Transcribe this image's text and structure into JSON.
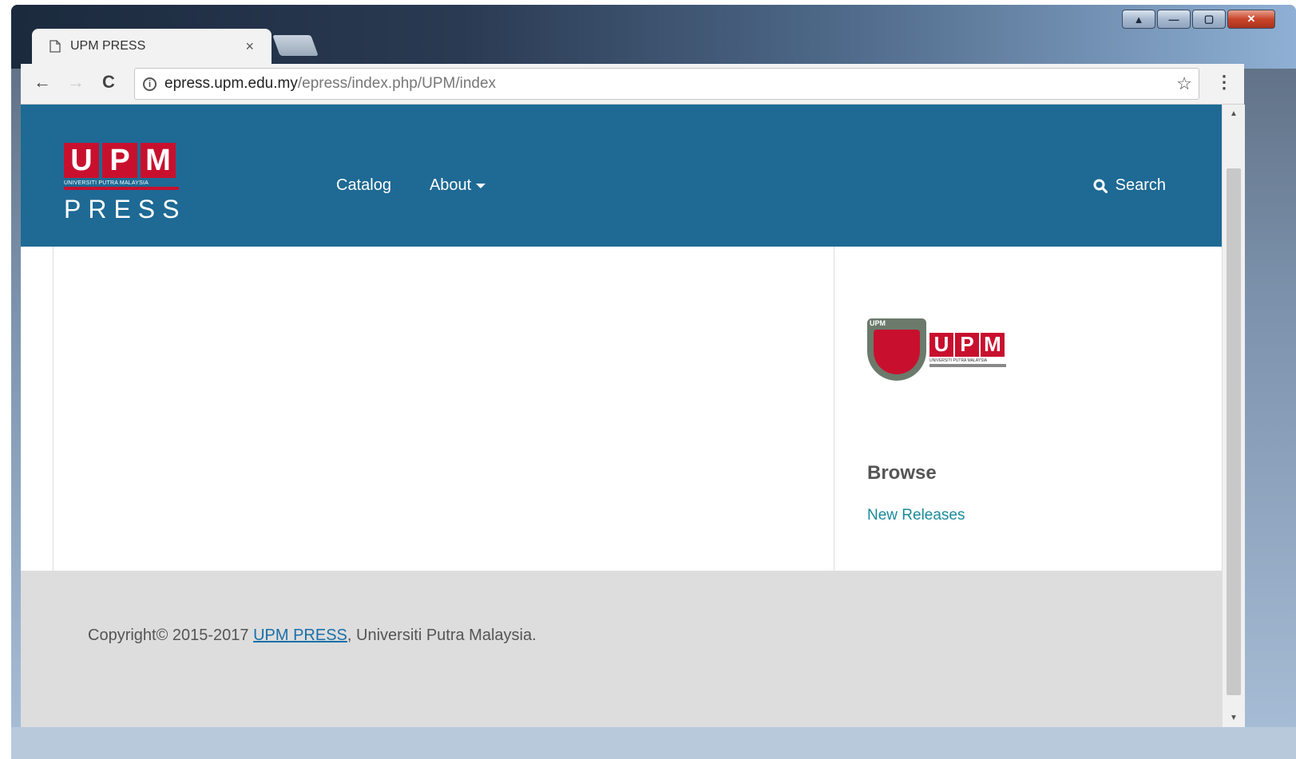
{
  "browser": {
    "tab_title": "UPM PRESS",
    "tab_close": "×",
    "url_host": "epress.upm.edu.my",
    "url_path": "/epress/index.php/UPM/index",
    "back_icon": "←",
    "forward_icon": "→",
    "reload_icon": "C",
    "info_icon": "i",
    "star_icon": "☆",
    "menu_icon": "⋮"
  },
  "window_controls": {
    "user": "▲",
    "minimize": "—",
    "maximize": "▢",
    "close": "✕"
  },
  "header": {
    "logo_letters": [
      "U",
      "P",
      "M"
    ],
    "logo_subtext": "UNIVERSITI PUTRA MALAYSIA",
    "logo_press": "PRESS",
    "nav": {
      "catalog": "Catalog",
      "about": "About"
    },
    "search_label": "Search",
    "background_color": "#1e6a94"
  },
  "sidebar": {
    "logo_letters": [
      "U",
      "P",
      "M"
    ],
    "logo_subtext": "UNIVERSITI PUTRA MALAYSIA",
    "shield_text": "UPM",
    "browse_title": "Browse",
    "browse_link": "New Releases"
  },
  "footer": {
    "copyright_prefix": "Copyright© 2015-2017 ",
    "copyright_link": "UPM PRESS",
    "copyright_suffix": ", Universiti Putra Malaysia."
  },
  "colors": {
    "brand_red": "#c8102e",
    "link_teal": "#1a8a9a"
  }
}
